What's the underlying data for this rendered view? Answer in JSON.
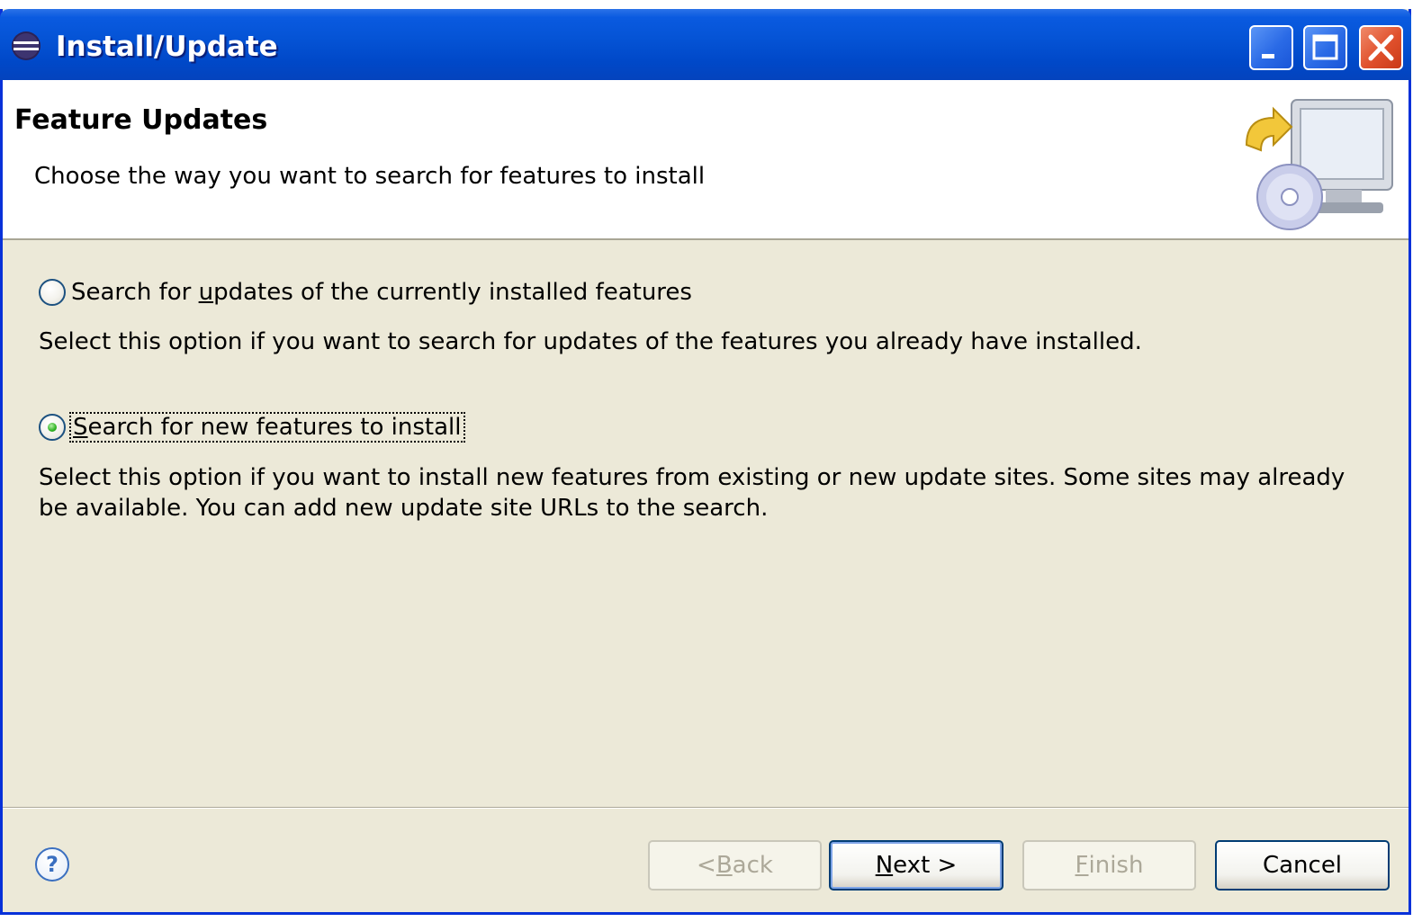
{
  "window": {
    "title": "Install/Update",
    "app_icon": "eclipse-icon",
    "controls": {
      "minimize_icon": "minimize-icon",
      "maximize_icon": "maximize-icon",
      "close_icon": "close-icon"
    },
    "titlebar_color": "#0554d6"
  },
  "header": {
    "title": "Feature Updates",
    "description": "Choose the way you want to search for features to install",
    "graphic_icon": "install-update-computer-cd-icon"
  },
  "options": [
    {
      "label_pre": "Search for ",
      "label_mnemonic": "u",
      "label_post": "pdates of the currently installed features",
      "selected": false,
      "description": "Select this option if you want to search for updates of the features you already have installed."
    },
    {
      "label_pre": "",
      "label_mnemonic": "S",
      "label_post": "earch for new features to install",
      "selected": true,
      "description": "Select this option if you want to install new features from existing or new update sites. Some sites may already be available. You can add new update site URLs to the search."
    }
  ],
  "footer": {
    "help_icon": "help-icon",
    "buttons": {
      "back": {
        "pre": "< ",
        "mnemonic": "B",
        "post": "ack",
        "enabled": false
      },
      "next": {
        "pre": "",
        "mnemonic": "N",
        "post": "ext >",
        "enabled": true
      },
      "finish": {
        "pre": "",
        "mnemonic": "F",
        "post": "inish",
        "enabled": false
      },
      "cancel": {
        "pre": "Cancel",
        "mnemonic": "",
        "post": "",
        "enabled": true
      }
    }
  }
}
